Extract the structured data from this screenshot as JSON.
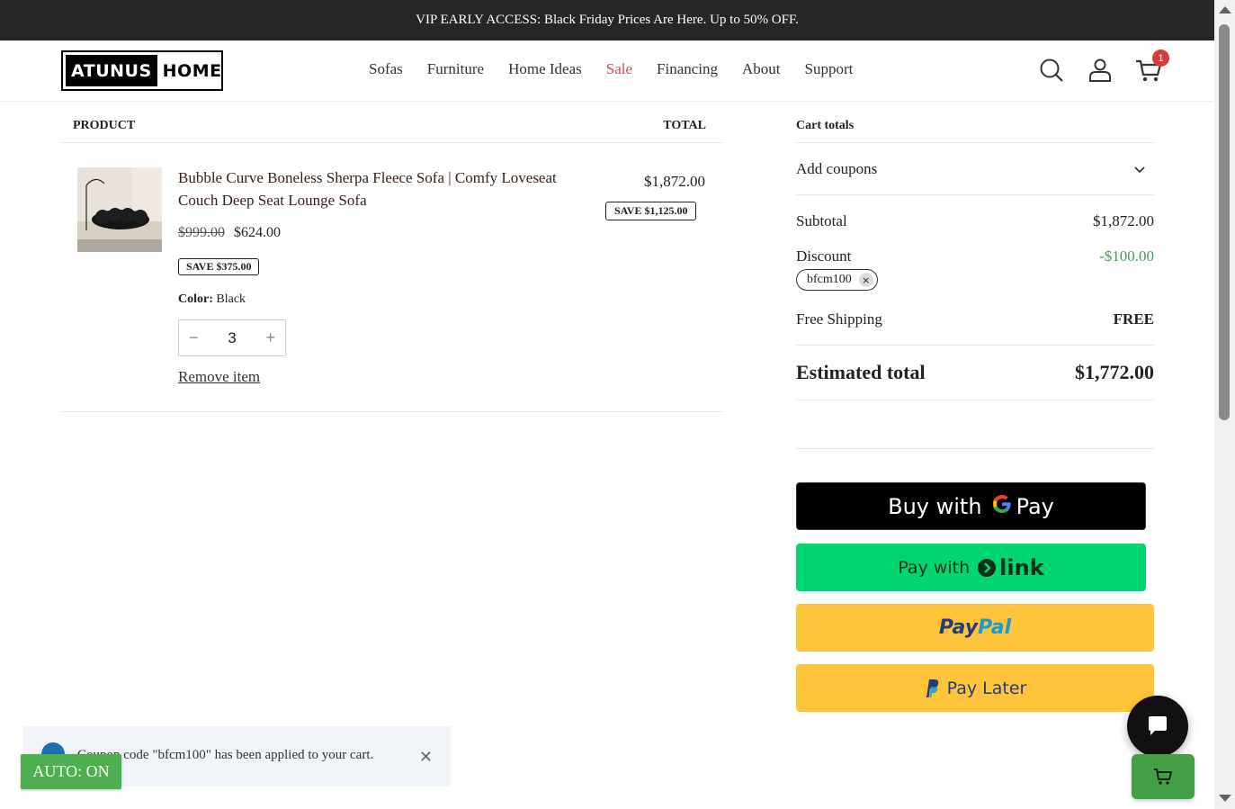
{
  "announcement": "VIP EARLY ACCESS: Black Friday Prices Are Here. Up to 50% OFF.",
  "logo": {
    "part1": "ATUNUS",
    "part2": "HOME"
  },
  "nav": [
    "Sofas",
    "Furniture",
    "Home Ideas",
    "Sale",
    "Financing",
    "About",
    "Support"
  ],
  "cart_count": "1",
  "table": {
    "product_header": "PRODUCT",
    "total_header": "TOTAL"
  },
  "item": {
    "name": "Bubble Curve Boneless Sherpa Fleece Sofa | Comfy Loveseat Couch Deep Seat Lounge Sofa",
    "old_price": "$999.00",
    "price": "$624.00",
    "save": "SAVE $375.00",
    "color_label": "Color:",
    "color_value": "Black",
    "quantity": "3",
    "minus": "−",
    "plus": "+",
    "remove": "Remove item",
    "line_total": "$1,872.00",
    "line_save": "SAVE $1,125.00"
  },
  "cart_totals": {
    "title": "Cart totals",
    "coupons_label": "Add coupons",
    "subtotal_label": "Subtotal",
    "subtotal_value": "$1,872.00",
    "discount_label": "Discount",
    "discount_value": "-$100.00",
    "coupon_code": "bfcm100",
    "coupon_remove": "×",
    "shipping_label": "Free Shipping",
    "shipping_value": "FREE",
    "estimated_label": "Estimated total",
    "estimated_value": "$1,772.00"
  },
  "payments": {
    "gpay_prefix": "Buy with",
    "gpay_g": "G",
    "gpay_suffix": "Pay",
    "link_prefix": "Pay with",
    "link_brand": "link",
    "paypal_1": "Pay",
    "paypal_2": "Pal",
    "paylater_label": "Pay Later"
  },
  "toast": {
    "message": "Coupon code \"bfcm100\" has been applied to your cart.",
    "close": "✕"
  },
  "auto_button": "AUTO: ON",
  "colors": {
    "sale": "#e2464b",
    "discount": "#4c9a55",
    "link_green": "#00d66f",
    "paypal_yellow": "#ffc439",
    "auto_green": "#4caf50"
  }
}
